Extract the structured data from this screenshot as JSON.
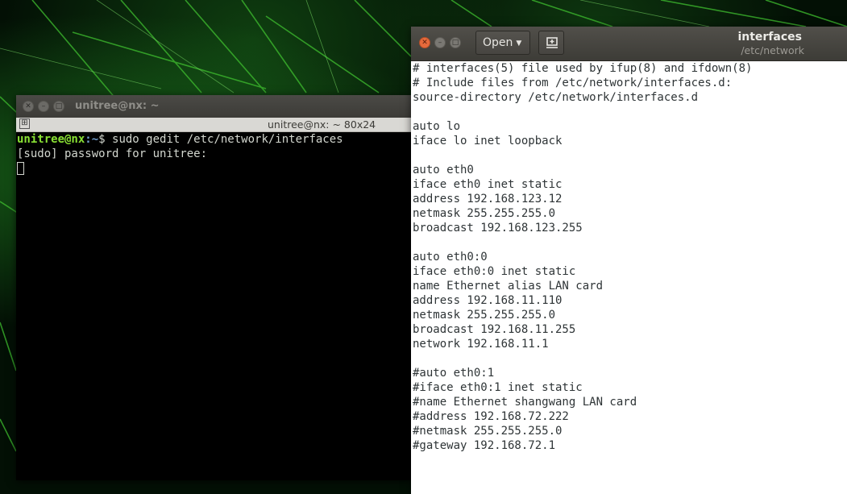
{
  "terminal": {
    "window_title": "unitree@nx: ~",
    "tab_title": "unitree@nx: ~ 80x24",
    "prompt_user_host": "unitree@nx",
    "prompt_path": ":~",
    "prompt_symbol": "$ ",
    "command": "sudo gedit /etc/network/interfaces",
    "output_line": "[sudo] password for unitree:",
    "close_icon": "close-icon",
    "colors": {
      "background": "#000000",
      "user": "#8ae234",
      "path": "#729fcf",
      "text": "#d3d7cf"
    }
  },
  "gedit": {
    "open_label": "Open",
    "doc_title": "interfaces",
    "doc_path": "/etc/network",
    "lines": [
      "# interfaces(5) file used by ifup(8) and ifdown(8)",
      "# Include files from /etc/network/interfaces.d:",
      "source-directory /etc/network/interfaces.d",
      "",
      "auto lo",
      "iface lo inet loopback",
      "",
      "auto eth0",
      "iface eth0 inet static",
      "address 192.168.123.12",
      "netmask 255.255.255.0",
      "broadcast 192.168.123.255",
      "",
      "auto eth0:0",
      "iface eth0:0 inet static",
      "name Ethernet alias LAN card",
      "address 192.168.11.110",
      "netmask 255.255.255.0",
      "broadcast 192.168.11.255",
      "network 192.168.11.1",
      "",
      "#auto eth0:1",
      "#iface eth0:1 inet static",
      "#name Ethernet shangwang LAN card",
      "#address 192.168.72.222",
      "#netmask 255.255.255.0",
      "#gateway 192.168.72.1"
    ],
    "colors": {
      "close_button": "#e66a3c",
      "header": "#3d3c37",
      "text": "#2e3436"
    }
  }
}
